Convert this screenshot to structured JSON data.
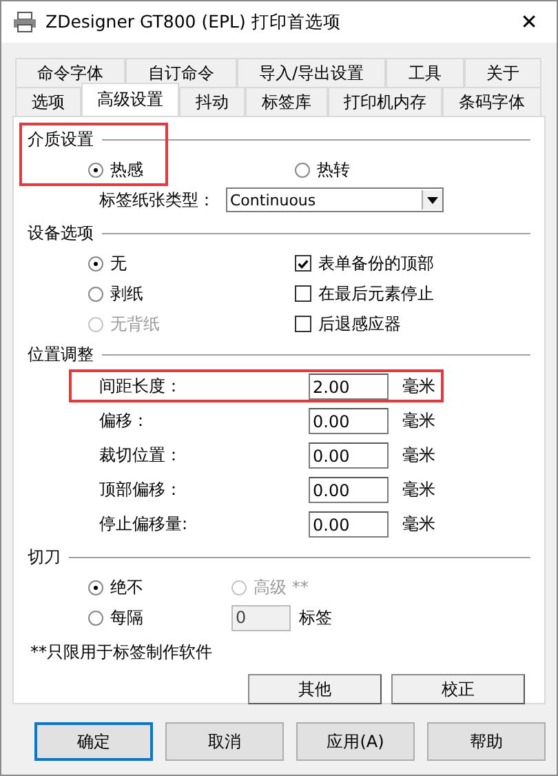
{
  "window": {
    "title": "ZDesigner GT800 (EPL) 打印首选项",
    "close": "✕"
  },
  "tab_rows": [
    [
      {
        "label": "命令字体",
        "selected": false
      },
      {
        "label": "自订命令",
        "selected": false
      },
      {
        "label": "导入/导出设置",
        "selected": false
      },
      {
        "label": "工具",
        "selected": false
      },
      {
        "label": "关于",
        "selected": false
      }
    ],
    [
      {
        "label": "选项",
        "selected": false
      },
      {
        "label": "高级设置",
        "selected": true
      },
      {
        "label": "抖动",
        "selected": false
      },
      {
        "label": "标签库",
        "selected": false
      },
      {
        "label": "打印机内存",
        "selected": false
      },
      {
        "label": "条码字体",
        "selected": false
      }
    ]
  ],
  "media": {
    "title": "介质设置",
    "highlighted": true,
    "options": [
      {
        "label": "热感",
        "selected": true
      },
      {
        "label": "热转",
        "selected": false
      }
    ],
    "paper_type": {
      "label": "标签纸张类型：",
      "value": "Continuous"
    }
  },
  "device": {
    "title": "设备选项",
    "radios": [
      {
        "label": "无",
        "selected": true,
        "disabled": false
      },
      {
        "label": "剥纸",
        "selected": false,
        "disabled": false
      },
      {
        "label": "无背纸",
        "selected": false,
        "disabled": true
      }
    ],
    "checkboxes": [
      {
        "label": "表单备份的顶部",
        "checked": true
      },
      {
        "label": "在最后元素停止",
        "checked": false
      },
      {
        "label": "后退感应器",
        "checked": false
      }
    ]
  },
  "position": {
    "title": "位置调整",
    "fields": [
      {
        "label": "间距长度：",
        "value": "2.00",
        "unit": "毫米",
        "highlighted": true
      },
      {
        "label": "偏移：",
        "value": "0.00",
        "unit": "毫米",
        "highlighted": false
      },
      {
        "label": "裁切位置：",
        "value": "0.00",
        "unit": "毫米",
        "highlighted": false
      },
      {
        "label": "顶部偏移：",
        "value": "0.00",
        "unit": "毫米",
        "highlighted": false
      },
      {
        "label": "停止偏移量:",
        "value": "0.00",
        "unit": "毫米",
        "highlighted": false
      }
    ]
  },
  "cutter": {
    "title": "切刀",
    "options": [
      {
        "label": "绝不",
        "selected": true,
        "disabled": false
      },
      {
        "label": "高级 **",
        "selected": false,
        "disabled": true
      },
      {
        "label": "每隔",
        "selected": false,
        "disabled": false
      }
    ],
    "interval": {
      "value": "0",
      "unit": "标签",
      "disabled": true
    }
  },
  "note": "**只限用于标签制作软件",
  "panel_buttons": [
    "其他",
    "校正"
  ],
  "footer_buttons": [
    {
      "label": "确定",
      "default": true
    },
    {
      "label": "取消",
      "default": false
    },
    {
      "label": "应用(A)",
      "default": false
    },
    {
      "label": "帮助",
      "default": false
    }
  ]
}
